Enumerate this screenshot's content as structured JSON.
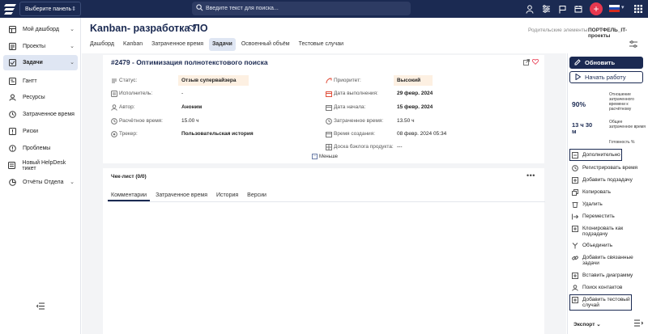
{
  "topbar": {
    "panel_select": "Выберите панель",
    "search_placeholder": "Введите текст для поиска..."
  },
  "sidebar": {
    "items": [
      {
        "label": "Мой дашборд",
        "icon": "dashboard-icon",
        "has_chevron": true
      },
      {
        "label": "Проекты",
        "icon": "projects-icon",
        "has_chevron": true
      },
      {
        "label": "Задачи",
        "icon": "tasks-icon",
        "has_chevron": true,
        "active": true
      },
      {
        "label": "Гантт",
        "icon": "gantt-icon"
      },
      {
        "label": "Ресурсы",
        "icon": "resources-icon"
      },
      {
        "label": "Затраченное время",
        "icon": "clock-icon"
      },
      {
        "label": "Риски",
        "icon": "risks-icon"
      },
      {
        "label": "Проблемы",
        "icon": "problems-icon"
      },
      {
        "label": "Новый HelpDesk тикет",
        "icon": "helpdesk-icon"
      },
      {
        "label": "Отчёты Отдела",
        "icon": "reports-icon",
        "has_chevron": true
      }
    ]
  },
  "header": {
    "title": "Kanban- разработка ПО",
    "parent_label": "Родительские элементы:",
    "parent_value": "ПОРТФЕЛЬ_IT-проекты",
    "tabs": [
      "Дашборд",
      "Kanban",
      "Затраченное время",
      "Задачи",
      "Освоенный объём",
      "Тестовые случаи"
    ],
    "active_tab": 3
  },
  "issue": {
    "title": "#2479 - Оптимизация полнотекстового поиска",
    "left_fields": [
      {
        "label": "Статус:",
        "value": "Отзыв супервайзера",
        "bold": true
      },
      {
        "label": "Исполнитель:",
        "value": "-",
        "bold": false
      },
      {
        "label": "Автор:",
        "value": "Аноним",
        "bold": true
      },
      {
        "label": "Расчётное время:",
        "value": "15.00 ч",
        "bold": false
      },
      {
        "label": "Трекер:",
        "value": "Пользовательская история",
        "bold": true
      }
    ],
    "right_fields": [
      {
        "label": "Приоритет:",
        "value": "Высокий",
        "bold": true
      },
      {
        "label": "Дата выполнения:",
        "value": "29 февр. 2024",
        "bold": true
      },
      {
        "label": "Дата начала:",
        "value": "15 февр. 2024",
        "bold": true
      },
      {
        "label": "Затраченное время:",
        "value": "13.50 ч",
        "bold": false
      },
      {
        "label": "Время создания:",
        "value": "08 февр. 2024 05:34",
        "bold": false
      },
      {
        "label": "Доска бэклога продукта:",
        "value": "---",
        "bold": false
      }
    ],
    "less_label": "Меньше"
  },
  "checklist": {
    "title": "Чек-лист (0/0)",
    "tabs": [
      "Комментарии",
      "Затраченное время",
      "История",
      "Версии"
    ],
    "active_tab": 0
  },
  "right_panel": {
    "update_button": "Обновить",
    "start_button": "Начать работу",
    "percent_value": "90%",
    "percent_label": "Отношение затраченного времени к расчётному",
    "time_value": "13 ч 30 м",
    "time_label": "Общее затраченное время",
    "ready_label": "Готовность %",
    "actions": [
      {
        "label": "Дополнительно",
        "icon": "minus-square-icon"
      },
      {
        "label": "Регистрировать время",
        "icon": "clock-icon"
      },
      {
        "label": "Добавить подзадачу",
        "icon": "plus-square-icon"
      },
      {
        "label": "Копировать",
        "icon": "copy-icon"
      },
      {
        "label": "Удалить",
        "icon": "trash-icon"
      },
      {
        "label": "Переместить",
        "icon": "move-icon"
      },
      {
        "label": "Клонировать как подзадачу",
        "icon": "clone-icon"
      },
      {
        "label": "Объединить",
        "icon": "merge-icon"
      },
      {
        "label": "Добавить связанные задачи",
        "icon": "link-icon"
      },
      {
        "label": "Вставить диаграмму",
        "icon": "plus-square-icon"
      },
      {
        "label": "Поиск контактов",
        "icon": "user-icon"
      },
      {
        "label": "Добавить тестовый случай",
        "icon": "plus-square-icon"
      }
    ],
    "export_label": "Экспорт"
  },
  "colors": {
    "navy": "#1b2a52",
    "accent_red": "#e8384f",
    "active_bg": "#dfe6f3",
    "highlight_orange": "#fdf0e2"
  }
}
